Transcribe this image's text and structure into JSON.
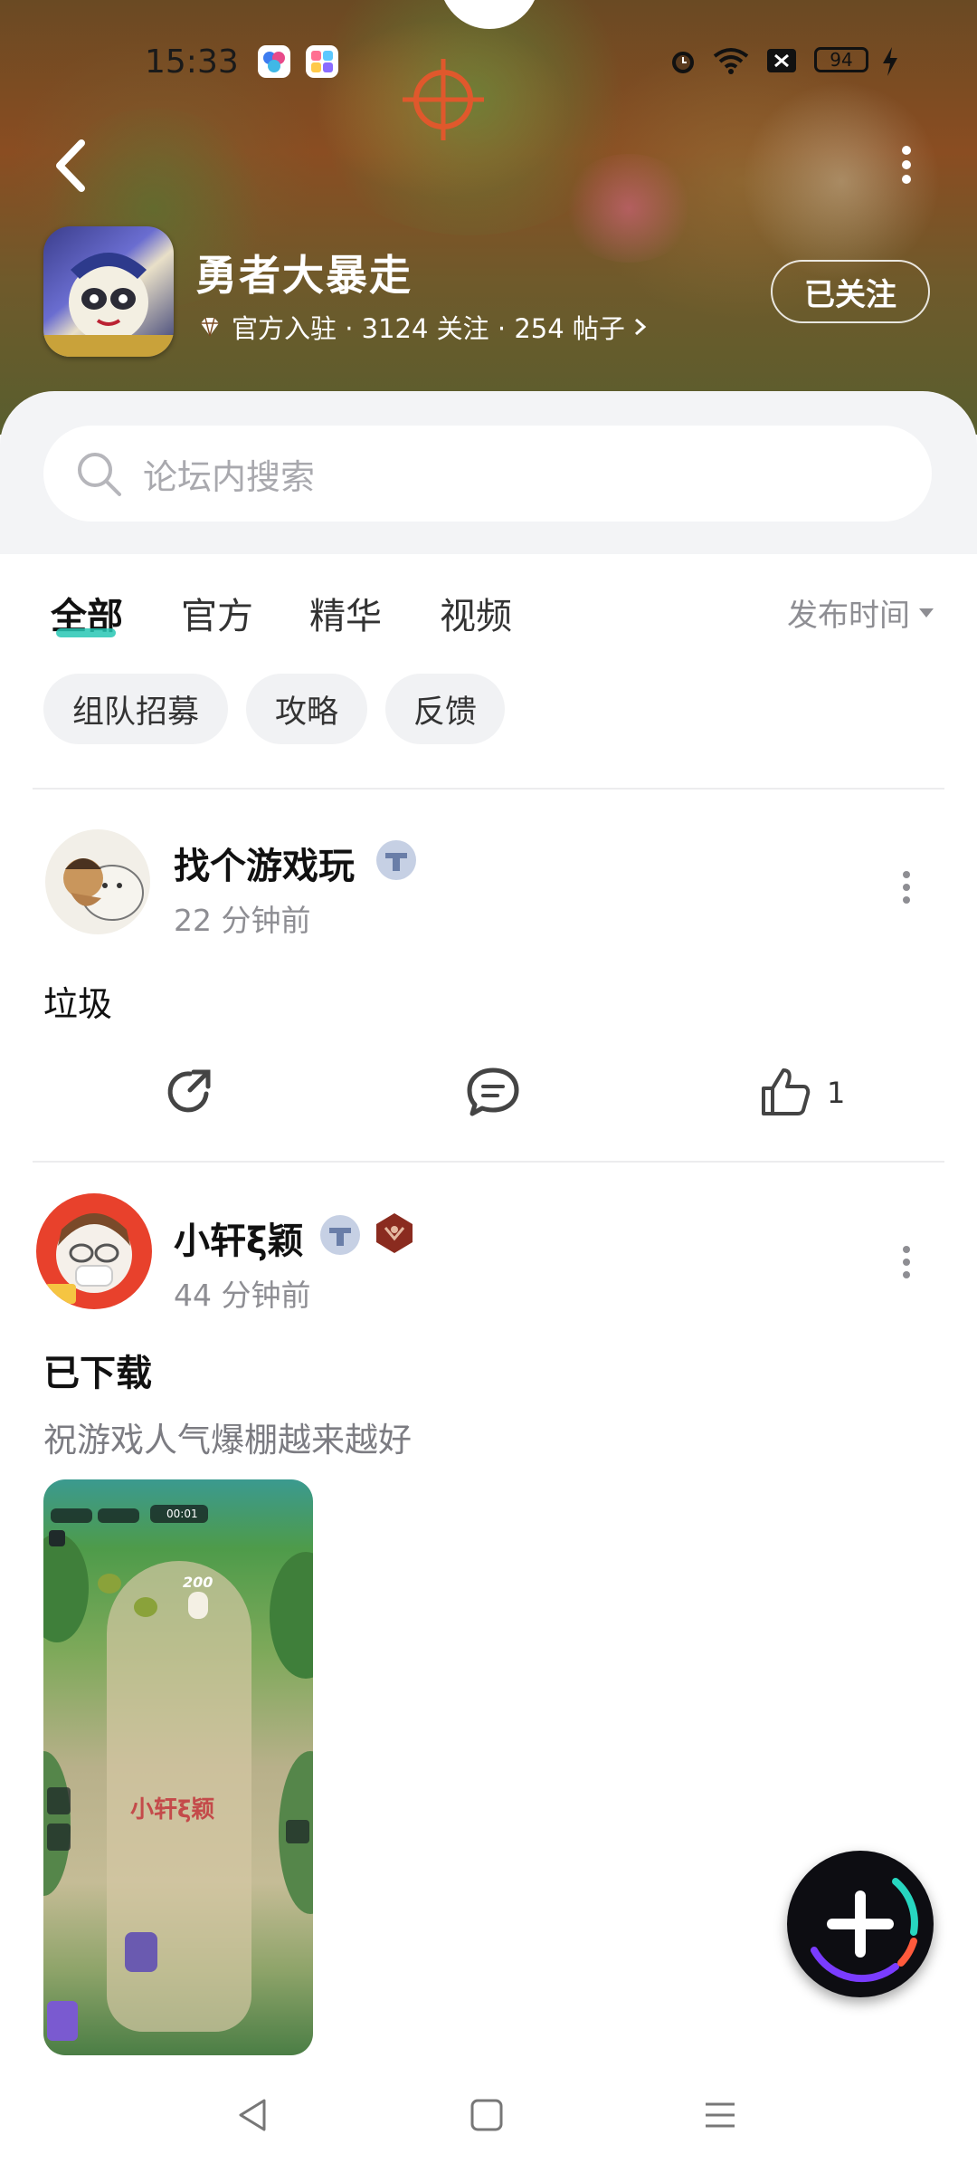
{
  "status_bar": {
    "time": "15:33",
    "battery": "94",
    "icons": [
      "app-icon-1",
      "app-icon-2",
      "alarm-icon",
      "wifi-icon",
      "sim-off-icon",
      "battery-icon",
      "charging-icon"
    ]
  },
  "header": {
    "game_name": "勇者大暴走",
    "meta": "官方入驻 · 3124 关注 · 254 帖子",
    "follow_label": "已关注"
  },
  "search": {
    "placeholder": "论坛内搜索"
  },
  "tabs": [
    {
      "label": "全部",
      "active": true
    },
    {
      "label": "官方",
      "active": false
    },
    {
      "label": "精华",
      "active": false
    },
    {
      "label": "视频",
      "active": false
    }
  ],
  "sort_label": "发布时间",
  "chips": [
    {
      "label": "组队招募"
    },
    {
      "label": "攻略"
    },
    {
      "label": "反馈"
    }
  ],
  "posts": [
    {
      "username": "找个游戏玩",
      "time": "22 分钟前",
      "body": "垃圾",
      "like_count": "1"
    },
    {
      "username": "小轩ξ颖",
      "time": "44 分钟前",
      "title": "已下载",
      "subtitle": "祝游戏人气爆棚越来越好",
      "image_watermark": "小轩ξ颖",
      "hud_timer": "00:01",
      "hud_score": "200"
    }
  ],
  "colors": {
    "accent": "#27c7b4",
    "muted_text": "#8e8e93",
    "chip_bg": "#f1f2f4"
  }
}
